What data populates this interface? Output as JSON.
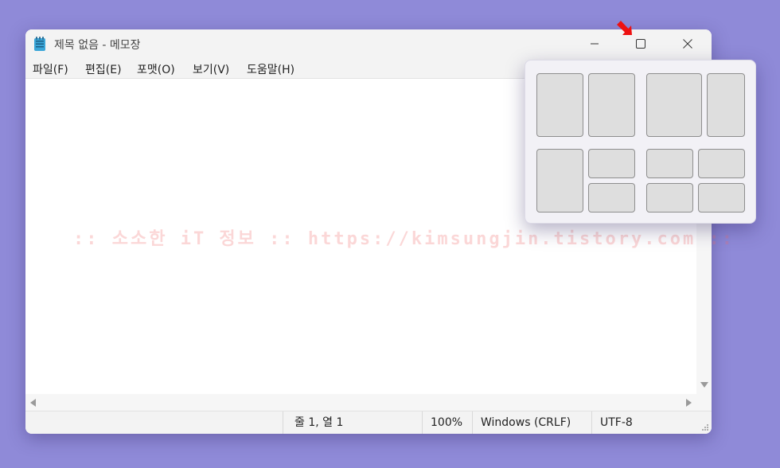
{
  "window": {
    "title": "제목 없음 - 메모장"
  },
  "menu": [
    {
      "label": "파일(F)"
    },
    {
      "label": "편집(E)"
    },
    {
      "label": "포맷(O)"
    },
    {
      "label": "보기(V)"
    },
    {
      "label": "도움말(H)"
    }
  ],
  "editor": {
    "content": ""
  },
  "status": {
    "position": "줄 1, 열 1",
    "zoom": "100%",
    "line_ending": "Windows (CRLF)",
    "encoding": "UTF-8"
  },
  "watermark": {
    "text": ":: 소소한 iT 정보 :: https://kimsungjin.tistory.com ::"
  },
  "snap_layouts": {
    "layouts": [
      "two-equal-columns",
      "wide-left-narrow-right",
      "left-column-right-stacked",
      "four-quadrants"
    ]
  },
  "icons": {
    "app": "notepad-icon",
    "minimize": "minimize-icon",
    "maximize": "maximize-icon",
    "close": "close-icon",
    "pointer": "red-arrow-pointer-icon"
  },
  "colors": {
    "desktop": "#8f8ad8",
    "pointer": "#ee1111",
    "watermark": "#f06e6e"
  }
}
